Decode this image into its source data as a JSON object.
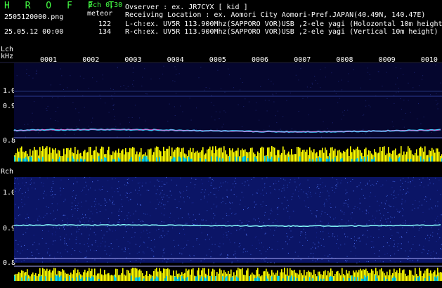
{
  "header": {
    "app_title": "H R O F F T",
    "version": "2ch 0.30",
    "filename": "2505120000.png",
    "mode": "meteor",
    "count_l": "122",
    "count_r": "134",
    "datetime": "25.05.12 00:00"
  },
  "meta": {
    "observer": "Ovserver           : ex. JR7CYX [ kid ]",
    "location": "Receiving Location : ex. Aomori City Aomori-Pref.JAPAN(40.49N, 140.47E)",
    "lch": "L-ch:ex. UV5R 113.900Mhz(SAPPORO VOR)USB ,2-ele yagi (Holozontal 10m height",
    "rch": "R-ch:ex. UV5R 113.900Mhz(SAPPORO VOR)USB ,2-ele yagi (Vertical 10m height)"
  },
  "lch": {
    "label": "Lch",
    "unit": "kHz",
    "ticks": [
      "1.0",
      "0.9",
      "0.8"
    ]
  },
  "rch": {
    "label": "Rch",
    "ticks": [
      "1.0",
      "0.9",
      "0.8"
    ]
  },
  "segments": [
    "0001",
    "0002",
    "0003",
    "0004",
    "0005",
    "0006",
    "0007",
    "0008",
    "0009",
    "0010"
  ],
  "colors": {
    "title": "#44ff44",
    "text": "#ffffff",
    "trace_l": "#44ccff",
    "trace_r": "#88ffff",
    "bar_yellow": "#ffff00",
    "bar_cyan": "#00e0ff",
    "band_dark": "#05062e",
    "band_blue": "#0b1566"
  }
}
